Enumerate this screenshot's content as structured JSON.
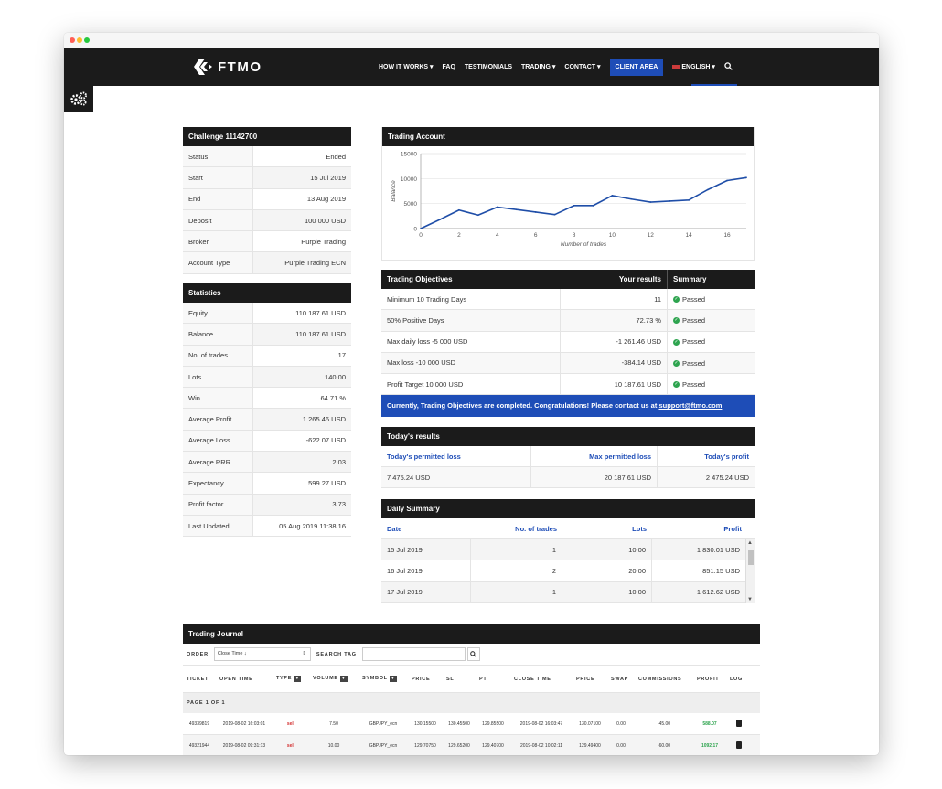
{
  "nav": {
    "logo_text": "FTMO",
    "items": [
      "HOW IT WORKS ▾",
      "FAQ",
      "TESTIMONIALS",
      "TRADING ▾",
      "CONTACT ▾"
    ],
    "client_area": "CLIENT AREA",
    "language": "ENGLISH ▾"
  },
  "challenge": {
    "title": "Challenge 11142700",
    "rows": [
      {
        "label": "Status",
        "value": "Ended"
      },
      {
        "label": "Start",
        "value": "15 Jul 2019"
      },
      {
        "label": "End",
        "value": "13 Aug 2019"
      },
      {
        "label": "Deposit",
        "value": "100 000 USD"
      },
      {
        "label": "Broker",
        "value": "Purple Trading"
      },
      {
        "label": "Account Type",
        "value": "Purple Trading ECN"
      }
    ]
  },
  "statistics": {
    "title": "Statistics",
    "rows": [
      {
        "label": "Equity",
        "value": "110 187.61 USD"
      },
      {
        "label": "Balance",
        "value": "110 187.61 USD"
      },
      {
        "label": "No. of trades",
        "value": "17"
      },
      {
        "label": "Lots",
        "value": "140.00"
      },
      {
        "label": "Win",
        "value": "64.71 %"
      },
      {
        "label": "Average Profit",
        "value": "1 265.46 USD"
      },
      {
        "label": "Average Loss",
        "value": "-622.07 USD"
      },
      {
        "label": "Average RRR",
        "value": "2.03"
      },
      {
        "label": "Expectancy",
        "value": "599.27 USD"
      },
      {
        "label": "Profit factor",
        "value": "3.73"
      },
      {
        "label": "Last Updated",
        "value": "05 Aug 2019 11:38:16"
      }
    ]
  },
  "trading_account": {
    "title": "Trading Account"
  },
  "chart_data": {
    "type": "line",
    "title": "",
    "xlabel": "Number of trades",
    "ylabel": "Balance",
    "xlim": [
      0,
      17
    ],
    "ylim": [
      0,
      15000
    ],
    "xticks": [
      0,
      2,
      4,
      6,
      8,
      10,
      12,
      14,
      16
    ],
    "yticks": [
      0,
      5000,
      10000,
      15000
    ],
    "grid": true,
    "color": "#1f4ea8",
    "x": [
      0,
      1,
      2,
      3,
      4,
      5,
      6,
      7,
      8,
      9,
      10,
      11,
      12,
      13,
      14,
      15,
      16,
      17
    ],
    "values": [
      0,
      1800,
      3700,
      2700,
      4300,
      3800,
      3300,
      2800,
      4600,
      4600,
      6600,
      5900,
      5300,
      5500,
      5700,
      7800,
      9600,
      10187
    ]
  },
  "objectives": {
    "title": "Trading Objectives",
    "col_results": "Your results",
    "col_summary": "Summary",
    "rows": [
      {
        "label": "Minimum 10 Trading Days",
        "result": "11",
        "summary": "Passed"
      },
      {
        "label": "50% Positive Days",
        "result": "72.73 %",
        "summary": "Passed"
      },
      {
        "label": "Max daily loss -5 000 USD",
        "result": "-1 261.46 USD",
        "summary": "Passed"
      },
      {
        "label": "Max loss -10 000 USD",
        "result": "-384.14 USD",
        "summary": "Passed"
      },
      {
        "label": "Profit Target 10 000 USD",
        "result": "10 187.61 USD",
        "summary": "Passed"
      }
    ],
    "banner_text": "Currently, Trading Objectives are completed. Congratulations! Please contact us at ",
    "banner_link": "support@ftmo.com"
  },
  "today": {
    "title": "Today's results",
    "headers": [
      "Today's permitted loss",
      "Max permitted loss",
      "Today's profit"
    ],
    "values": [
      "7 475.24 USD",
      "20 187.61 USD",
      "2 475.24 USD"
    ]
  },
  "daily": {
    "title": "Daily Summary",
    "headers": [
      "Date",
      "No. of trades",
      "Lots",
      "Profit"
    ],
    "rows": [
      {
        "date": "15 Jul 2019",
        "trades": "1",
        "lots": "10.00",
        "profit": "1 830.01 USD"
      },
      {
        "date": "16 Jul 2019",
        "trades": "2",
        "lots": "20.00",
        "profit": "851.15 USD"
      },
      {
        "date": "17 Jul 2019",
        "trades": "1",
        "lots": "10.00",
        "profit": "1 612.62 USD"
      }
    ]
  },
  "journal": {
    "title": "Trading Journal",
    "order_label": "ORDER",
    "order_value": "Close Time ↓",
    "search_label": "SEARCH TAG",
    "columns": [
      "TICKET",
      "OPEN TIME",
      "TYPE",
      "VOLUME",
      "SYMBOL",
      "PRICE",
      "SL",
      "PT",
      "CLOSE TIME",
      "PRICE",
      "SWAP",
      "COMMISSIONS",
      "PROFIT",
      "LOG"
    ],
    "page_label": "PAGE 1 OF 1",
    "rows": [
      {
        "ticket": "49339819",
        "open": "2019-08-02 16:03:01",
        "type": "sell",
        "volume": "7.50",
        "symbol": "GBPJPY_ecn",
        "price": "130.15500",
        "sl": "130.45500",
        "pt": "129.85500",
        "close": "2019-08-02 16:03:47",
        "cprice": "130.07100",
        "swap": "0.00",
        "comm": "-45.00",
        "profit": "588.07"
      },
      {
        "ticket": "49321944",
        "open": "2019-08-02 09:31:13",
        "type": "sell",
        "volume": "10.00",
        "symbol": "GBPJPY_ecn",
        "price": "129.70750",
        "sl": "129.65200",
        "pt": "129.40700",
        "close": "2019-08-02 10:02:11",
        "cprice": "129.49400",
        "swap": "0.00",
        "comm": "-60.00",
        "profit": "1092.17"
      }
    ]
  }
}
